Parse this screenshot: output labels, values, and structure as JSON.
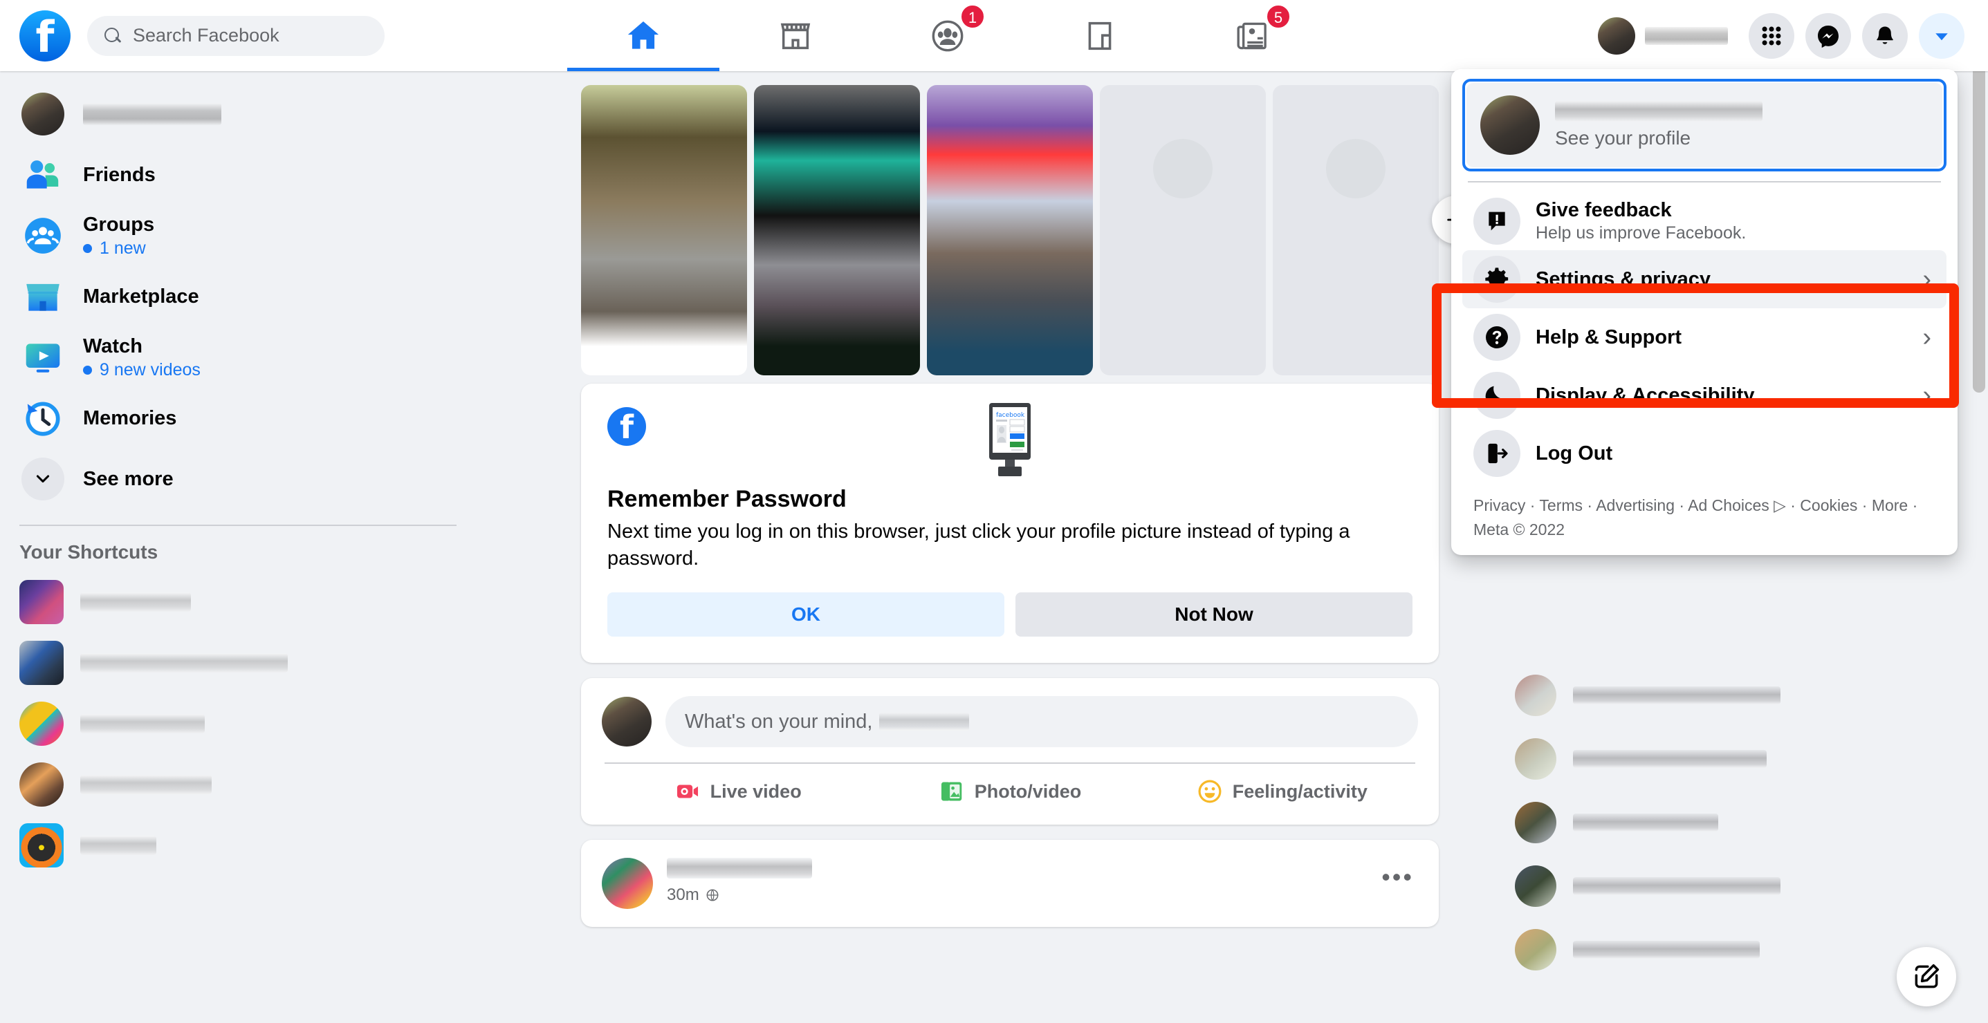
{
  "header": {
    "logo_icon": "facebook-logo",
    "search": {
      "placeholder": "Search Facebook",
      "icon": "search-icon",
      "value": ""
    },
    "nav_tabs": [
      {
        "name": "home",
        "icon": "home-icon",
        "active": true,
        "badge": ""
      },
      {
        "name": "marketplace",
        "icon": "marketplace-icon",
        "active": false,
        "badge": ""
      },
      {
        "name": "groups",
        "icon": "groups-icon",
        "active": false,
        "badge": "1"
      },
      {
        "name": "gaming",
        "icon": "gaming-icon",
        "active": false,
        "badge": ""
      },
      {
        "name": "news",
        "icon": "news-icon",
        "active": false,
        "badge": "5"
      }
    ],
    "account_name": "",
    "menu_button": {
      "icon": "grid-menu-icon"
    },
    "messenger_button": {
      "icon": "messenger-icon"
    },
    "notifications_button": {
      "icon": "bell-icon"
    },
    "account_button": {
      "icon": "chevron-down-icon"
    }
  },
  "sidebar": {
    "profile_name": "",
    "items": [
      {
        "label": "Friends",
        "icon": "friends-icon",
        "sub": ""
      },
      {
        "label": "Groups",
        "icon": "groups-icon",
        "sub": "1 new"
      },
      {
        "label": "Marketplace",
        "icon": "marketplace-icon",
        "sub": ""
      },
      {
        "label": "Watch",
        "icon": "watch-icon",
        "sub": "9 new videos"
      },
      {
        "label": "Memories",
        "icon": "memories-icon",
        "sub": ""
      },
      {
        "label": "See more",
        "icon": "chevron-down-icon",
        "sub": ""
      }
    ],
    "shortcuts_title": "Your Shortcuts",
    "shortcuts": [
      {
        "label": "",
        "thumb": "anime-group"
      },
      {
        "label": "",
        "thumb": "photo-person"
      },
      {
        "label": "",
        "thumb": "popart-faces"
      },
      {
        "label": "",
        "thumb": "person-sitting"
      },
      {
        "label": "",
        "thumb": "vinyl-record"
      }
    ]
  },
  "feed": {
    "stories": [
      {
        "type": "image"
      },
      {
        "type": "image"
      },
      {
        "type": "image"
      },
      {
        "type": "placeholder"
      },
      {
        "type": "placeholder"
      }
    ],
    "story_next_icon": "arrow-right-icon",
    "remember_password": {
      "title": "Remember Password",
      "body": "Next time you log in on this browser, just click your profile picture instead of typing a password.",
      "ok_label": "OK",
      "not_now_label": "Not Now",
      "close_icon": "close-icon",
      "fb_icon": "facebook-logo",
      "illustration": "monitor-login-illustration"
    },
    "composer": {
      "placeholder": "What's on your mind,",
      "actions": [
        {
          "label": "Live video",
          "icon": "live-video-icon"
        },
        {
          "label": "Photo/video",
          "icon": "photo-video-icon"
        },
        {
          "label": "Feeling/activity",
          "icon": "feeling-activity-icon"
        }
      ]
    },
    "post": {
      "author": "",
      "time": "30m",
      "privacy_icon": "globe-icon",
      "more_icon": "more-options-icon"
    }
  },
  "right_column": {
    "contacts": [
      {
        "name": ""
      },
      {
        "name": ""
      },
      {
        "name": ""
      },
      {
        "name": ""
      },
      {
        "name": ""
      }
    ],
    "compose_icon": "compose-message-icon"
  },
  "account_menu": {
    "profile": {
      "name": "",
      "subtitle": "See your profile"
    },
    "items": [
      {
        "label": "Give feedback",
        "sublabel": "Help us improve Facebook.",
        "icon": "feedback-icon",
        "chevron": false,
        "highlighted": false
      },
      {
        "label": "Settings & privacy",
        "sublabel": "",
        "icon": "gear-icon",
        "chevron": true,
        "highlighted": true
      },
      {
        "label": "Help & Support",
        "sublabel": "",
        "icon": "question-icon",
        "chevron": true,
        "highlighted": false
      },
      {
        "label": "Display & Accessibility",
        "sublabel": "",
        "icon": "moon-icon",
        "chevron": true,
        "highlighted": false
      },
      {
        "label": "Log Out",
        "sublabel": "",
        "icon": "logout-icon",
        "chevron": false,
        "highlighted": false
      }
    ],
    "chevron_glyph": "›",
    "footer": "Privacy · Terms · Advertising · Ad Choices ▷ · Cookies · More · Meta © 2022"
  },
  "annotation": {
    "highlight_color": "#f92a00",
    "target": "Settings & privacy"
  },
  "colors": {
    "brand_blue": "#1877f2",
    "badge_red": "#e41e3f",
    "page_bg": "#f0f2f5",
    "card_bg": "#ffffff",
    "text_primary": "#050505",
    "text_secondary": "#65676b"
  }
}
